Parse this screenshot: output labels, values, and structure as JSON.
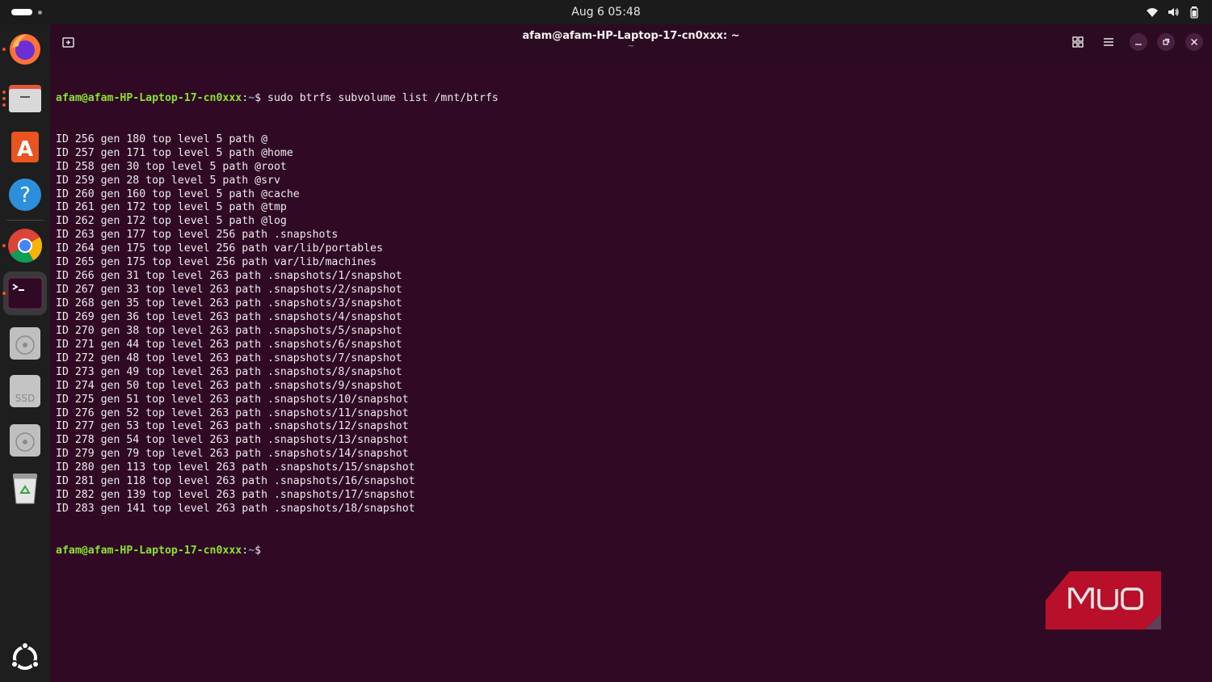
{
  "topbar": {
    "clock": "Aug 6  05:48",
    "icons": [
      "activities-indicator",
      "wifi-icon",
      "volume-icon",
      "battery-icon"
    ]
  },
  "dock": {
    "items": [
      {
        "name": "firefox",
        "icon": "firefox-icon"
      },
      {
        "name": "files",
        "icon": "files-icon"
      },
      {
        "name": "app-center",
        "icon": "app-center-icon"
      },
      {
        "name": "help",
        "icon": "help-icon"
      },
      {
        "name": "chrome",
        "icon": "chrome-icon"
      },
      {
        "name": "terminal",
        "icon": "terminal-icon",
        "active": true
      },
      {
        "name": "disk-1",
        "icon": "disk-icon"
      },
      {
        "name": "ssd",
        "icon": "ssd-icon",
        "label": "SSD"
      },
      {
        "name": "disk-2",
        "icon": "disk-icon"
      },
      {
        "name": "trash",
        "icon": "trash-icon"
      },
      {
        "name": "show-apps",
        "icon": "ubuntu-logo-icon"
      }
    ]
  },
  "window": {
    "title": "afam@afam-HP-Laptop-17-cn0xxx: ~",
    "subtitle": "~",
    "buttons": [
      "new-tab",
      "view-tabs",
      "menu",
      "minimize",
      "maximize",
      "close"
    ]
  },
  "terminal": {
    "prompt_user": "afam@afam-HP-Laptop-17-cn0xxx",
    "prompt_sep": ":",
    "prompt_path": "~",
    "prompt_symbol": "$",
    "command": " sudo btrfs subvolume list /mnt/btrfs",
    "output": [
      "ID 256 gen 180 top level 5 path @",
      "ID 257 gen 171 top level 5 path @home",
      "ID 258 gen 30 top level 5 path @root",
      "ID 259 gen 28 top level 5 path @srv",
      "ID 260 gen 160 top level 5 path @cache",
      "ID 261 gen 172 top level 5 path @tmp",
      "ID 262 gen 172 top level 5 path @log",
      "ID 263 gen 177 top level 256 path .snapshots",
      "ID 264 gen 175 top level 256 path var/lib/portables",
      "ID 265 gen 175 top level 256 path var/lib/machines",
      "ID 266 gen 31 top level 263 path .snapshots/1/snapshot",
      "ID 267 gen 33 top level 263 path .snapshots/2/snapshot",
      "ID 268 gen 35 top level 263 path .snapshots/3/snapshot",
      "ID 269 gen 36 top level 263 path .snapshots/4/snapshot",
      "ID 270 gen 38 top level 263 path .snapshots/5/snapshot",
      "ID 271 gen 44 top level 263 path .snapshots/6/snapshot",
      "ID 272 gen 48 top level 263 path .snapshots/7/snapshot",
      "ID 273 gen 49 top level 263 path .snapshots/8/snapshot",
      "ID 274 gen 50 top level 263 path .snapshots/9/snapshot",
      "ID 275 gen 51 top level 263 path .snapshots/10/snapshot",
      "ID 276 gen 52 top level 263 path .snapshots/11/snapshot",
      "ID 277 gen 53 top level 263 path .snapshots/12/snapshot",
      "ID 278 gen 54 top level 263 path .snapshots/13/snapshot",
      "ID 279 gen 79 top level 263 path .snapshots/14/snapshot",
      "ID 280 gen 113 top level 263 path .snapshots/15/snapshot",
      "ID 281 gen 118 top level 263 path .snapshots/16/snapshot",
      "ID 282 gen 139 top level 263 path .snapshots/17/snapshot",
      "ID 283 gen 141 top level 263 path .snapshots/18/snapshot"
    ]
  },
  "watermark": {
    "text": "MUO",
    "color": "#c8102e"
  },
  "colors": {
    "terminal_bg": "#300a24",
    "prompt_user": "#8ae234",
    "prompt_path": "#729fcf",
    "dock_bg": "#1e1e1e"
  }
}
